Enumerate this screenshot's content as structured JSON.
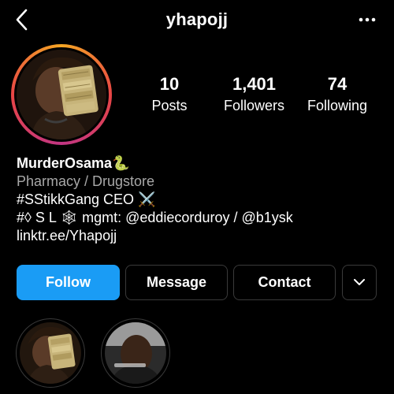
{
  "header": {
    "username": "yhapojj"
  },
  "stats": [
    {
      "value": "10",
      "label": "Posts"
    },
    {
      "value": "1,401",
      "label": "Followers"
    },
    {
      "value": "74",
      "label": "Following"
    }
  ],
  "bio": {
    "name": "MurderOsama🐍",
    "category": "Pharmacy / Drugstore",
    "line1": "#SStikkGang CEO ⚔️",
    "line2": "#◊ S L 🕸 mgmt: @eddiecorduroy / @b1ysk",
    "link": "linktr.ee/Yhapojj"
  },
  "actions": {
    "follow": "Follow",
    "message": "Message",
    "contact": "Contact"
  },
  "colors": {
    "background": "#000000",
    "follow_button": "#1a9cf5",
    "secondary_text": "#a8a8a8",
    "button_border": "#3a3a3a"
  },
  "icons": {
    "back": "chevron-left-icon",
    "more": "more-horizontal-icon",
    "expand": "chevron-down-icon"
  }
}
